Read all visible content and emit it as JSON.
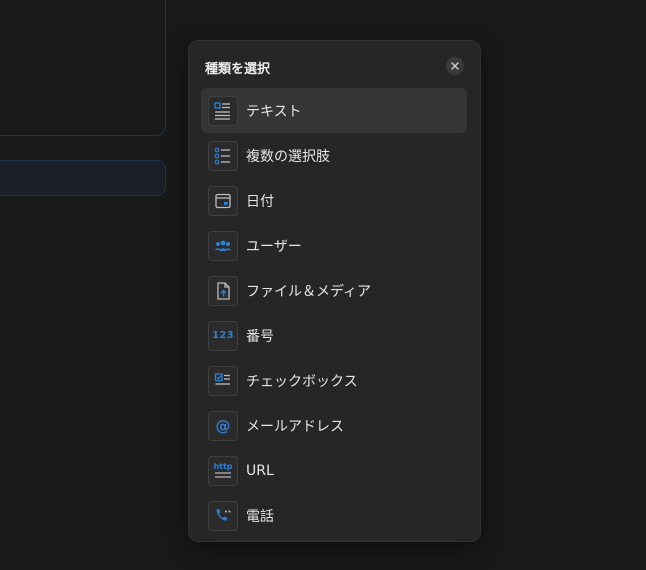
{
  "dialog": {
    "title": "種類を選択",
    "close_symbol": "✕"
  },
  "accent_color": "#2e7fd6",
  "items": [
    {
      "label": "テキスト",
      "icon": "text-icon",
      "selected": true
    },
    {
      "label": "複数の選択肢",
      "icon": "multi-select-icon",
      "selected": false
    },
    {
      "label": "日付",
      "icon": "calendar-icon",
      "selected": false
    },
    {
      "label": "ユーザー",
      "icon": "users-icon",
      "selected": false
    },
    {
      "label": "ファイル＆メディア",
      "icon": "file-upload-icon",
      "selected": false
    },
    {
      "label": "番号",
      "icon": "number-icon",
      "icon_text": "123",
      "selected": false
    },
    {
      "label": "チェックボックス",
      "icon": "checkbox-icon",
      "selected": false
    },
    {
      "label": "メールアドレス",
      "icon": "email-icon",
      "icon_text": "@",
      "selected": false
    },
    {
      "label": "URL",
      "icon": "url-icon",
      "icon_text": "http",
      "selected": false
    },
    {
      "label": "電話",
      "icon": "phone-icon",
      "selected": false
    }
  ]
}
